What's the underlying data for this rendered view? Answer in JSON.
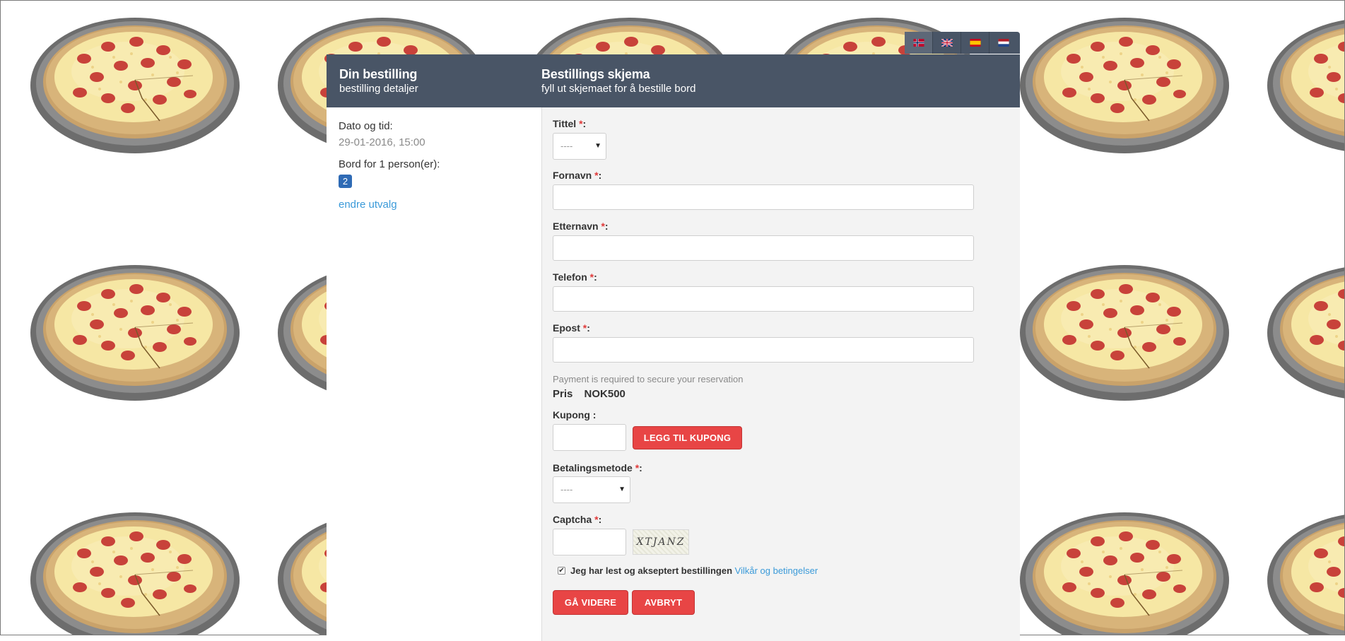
{
  "languages": [
    {
      "code": "no",
      "icon": "norway-flag-icon",
      "active": true
    },
    {
      "code": "en",
      "icon": "uk-flag-icon",
      "active": false
    },
    {
      "code": "es",
      "icon": "spain-flag-icon",
      "active": false
    },
    {
      "code": "nl",
      "icon": "netherlands-flag-icon",
      "active": false
    }
  ],
  "summary": {
    "title": "Din bestilling",
    "subtitle": "bestilling detaljer",
    "datetime_label": "Dato og tid:",
    "datetime_value": "29-01-2016, 15:00",
    "table_label": "Bord for 1 person(er):",
    "table_number": "2",
    "change_link": "endre utvalg"
  },
  "form": {
    "title": "Bestillings skjema",
    "subtitle": "fyll ut skjemaet for å bestille bord",
    "required_mark": "*",
    "title_label": "Tittel",
    "title_select_value": "----",
    "firstname_label": "Fornavn",
    "lastname_label": "Etternavn",
    "phone_label": "Telefon",
    "email_label": "Epost",
    "payment_note": "Payment is required to secure your reservation",
    "price_label": "Pris",
    "price_value": "NOK500",
    "coupon_label": "Kupong :",
    "coupon_button": "LEGG TIL KUPONG",
    "payment_method_label": "Betalingsmetode",
    "payment_method_value": "----",
    "captcha_label": "Captcha",
    "captcha_text": "XTJANZ",
    "terms_text": "Jeg har lest og akseptert bestillingen",
    "terms_link": "Vilkår og betingelser",
    "terms_checked": true,
    "continue_button": "GÅ VIDERE",
    "cancel_button": "AVBRYT"
  },
  "colors": {
    "header_bg": "#495566",
    "button_red": "#e84545",
    "link_blue": "#3a9ad9",
    "badge_blue": "#2f6bb5",
    "required_red": "#e03a3a"
  }
}
